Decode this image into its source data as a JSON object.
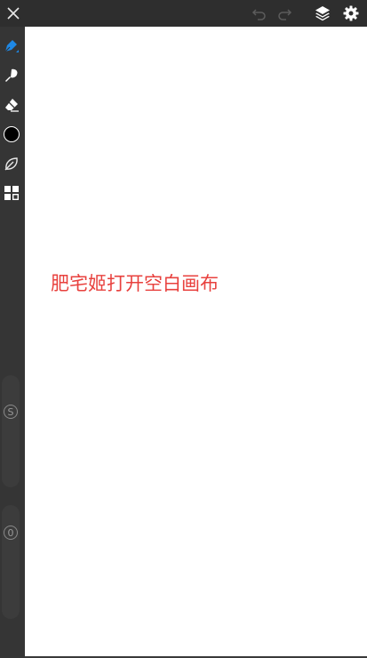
{
  "topbar": {
    "icons": [
      "close-icon",
      "undo-icon",
      "redo-icon",
      "layers-icon",
      "gear-icon"
    ],
    "colors": {
      "active": "#ffffff",
      "disabled": "#5c5c5c"
    }
  },
  "sidebar": {
    "tools": [
      "pen-icon",
      "brush-icon",
      "eraser-icon",
      "color-swatch",
      "leaf-icon",
      "grid-icon"
    ],
    "accent_color": "#1e88e5",
    "current_color": "#000000",
    "size_slider_label": "S",
    "opacity_slider_label": "0"
  },
  "canvas": {
    "message": "肥宅姬打开空白画布",
    "message_color": "#e8413e"
  }
}
